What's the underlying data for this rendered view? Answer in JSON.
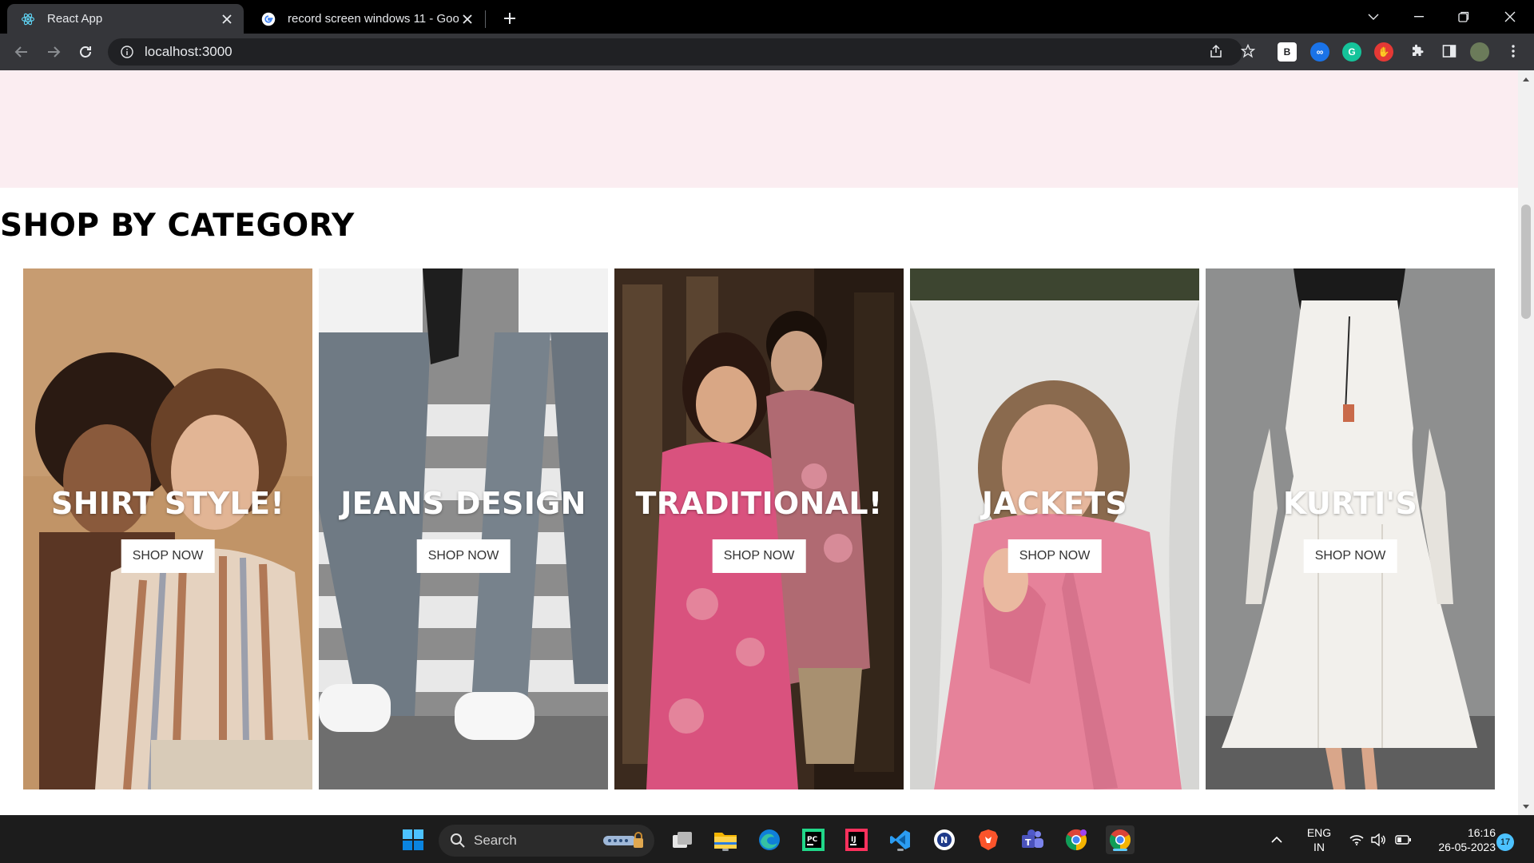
{
  "browser": {
    "tabs": [
      {
        "title": "React App",
        "active": true,
        "icon": "react-icon"
      },
      {
        "title": "record screen windows 11 - Goog",
        "active": false,
        "icon": "google-icon"
      }
    ],
    "url": "localhost:3000"
  },
  "page": {
    "section_title": "SHOP BY CATEGORY",
    "categories": [
      {
        "name": "SHIRT STYLE!",
        "button": "SHOP NOW"
      },
      {
        "name": "JEANS DESIGN",
        "button": "SHOP NOW"
      },
      {
        "name": "TRADITIONAL!",
        "button": "SHOP NOW"
      },
      {
        "name": "JACKETS",
        "button": "SHOP NOW"
      },
      {
        "name": "KURTI'S",
        "button": "SHOP NOW"
      }
    ],
    "colors": {
      "band": "#fbedf1",
      "title": "#000000"
    }
  },
  "taskbar": {
    "search_label": "Search",
    "apps": [
      "start-icon",
      "search",
      "task-view-icon",
      "file-explorer-icon",
      "edge-icon",
      "pycharm-icon",
      "intellij-icon",
      "vscode-icon",
      "app-icon",
      "brave-icon",
      "teams-icon",
      "chrome-profile-icon",
      "chrome-icon"
    ],
    "lang_top": "ENG",
    "lang_bottom": "IN",
    "time": "16:16",
    "date": "26-05-2023",
    "notifications": "17"
  }
}
